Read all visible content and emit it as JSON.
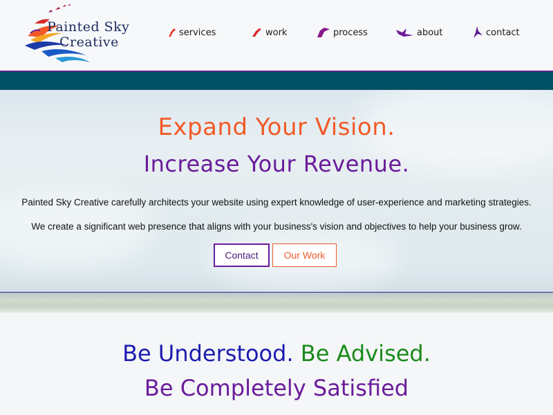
{
  "brand": {
    "line1": "Painted Sky",
    "line2": "Creative"
  },
  "nav": [
    {
      "label": "services",
      "icon": "red-bird-icon"
    },
    {
      "label": "work",
      "icon": "red-bird-icon"
    },
    {
      "label": "process",
      "icon": "purple-bird-icon"
    },
    {
      "label": "about",
      "icon": "purple-bird-icon"
    },
    {
      "label": "contact",
      "icon": "purple-bird-icon"
    }
  ],
  "hero": {
    "headline": "Expand Your Vision.",
    "subheadline": "Increase Your Revenue.",
    "paragraph1": "Painted Sky Creative carefully architects your website using expert knowledge of user-experience and marketing strategies.",
    "paragraph2": "We create a significant web presence that aligns with your business's vision and objectives to help your business grow.",
    "contact_button": "Contact",
    "work_button": "Our Work"
  },
  "tagline": {
    "part1": "Be Understood.",
    "part2": "Be Advised.",
    "line2": "Be Completely Satisfied"
  },
  "colors": {
    "orange": "#f25a28",
    "purple": "#6a1b9a",
    "blue": "#1c1cae",
    "green": "#1a8a1a",
    "teal": "#004f63"
  }
}
